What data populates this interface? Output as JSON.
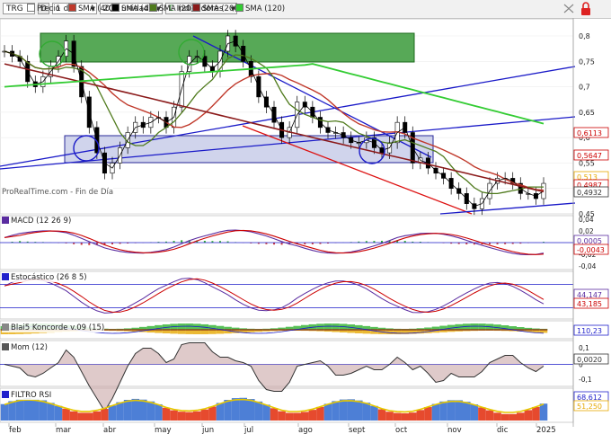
{
  "toolbar": {
    "ticker": "TRG",
    "badge": "D",
    "period": "1 día",
    "units": "200 unidades",
    "indicators_label": "Indicadores"
  },
  "legend": [
    {
      "label": "Precio",
      "color": "#ffffff"
    },
    {
      "label": "SMA (40)",
      "color": "#c0392b"
    },
    {
      "label": "SMA (4)",
      "color": "#000000"
    },
    {
      "label": "SMA (20)",
      "color": "#4f7a1c"
    },
    {
      "label": "SMA (200)",
      "color": "#8b1a1a"
    },
    {
      "label": "SMA (120)",
      "color": "#33cc33"
    }
  ],
  "watermark": "ProRealTime.com - Fin de Día",
  "panels": {
    "macd": {
      "title": "MACD (12 26 9)",
      "color": "#5a2ca0"
    },
    "stoch": {
      "title": "Estocástico (26 8 5)",
      "color": "#2222cc"
    },
    "blai5": {
      "title": "Blai5 Koncorde v.09 (15)",
      "color": "#888888"
    },
    "mom": {
      "title": "Mom (12)",
      "color": "#555555"
    },
    "rsi": {
      "title": "FILTRO RSI",
      "color": "#2222cc"
    }
  },
  "chart_data": {
    "type": "candlestick",
    "x_axis_labels": [
      "feb",
      "mar",
      "abr",
      "may",
      "jun",
      "jul",
      "ago",
      "sept",
      "oct",
      "nov",
      "dic",
      "2025"
    ],
    "price": {
      "ylim": [
        0.45,
        0.82
      ],
      "y_ticks": [
        "0,8",
        "0,75",
        "0,7",
        "0,65",
        "0,6",
        "0,55",
        "0,5",
        "0,45"
      ],
      "close_series": [
        0.77,
        0.76,
        0.75,
        0.71,
        0.7,
        0.72,
        0.74,
        0.76,
        0.79,
        0.74,
        0.68,
        0.62,
        0.57,
        0.53,
        0.55,
        0.58,
        0.61,
        0.63,
        0.62,
        0.64,
        0.64,
        0.62,
        0.66,
        0.73,
        0.76,
        0.76,
        0.74,
        0.73,
        0.77,
        0.8,
        0.78,
        0.75,
        0.72,
        0.68,
        0.66,
        0.63,
        0.6,
        0.62,
        0.67,
        0.66,
        0.64,
        0.62,
        0.61,
        0.61,
        0.6,
        0.59,
        0.59,
        0.6,
        0.58,
        0.57,
        0.59,
        0.63,
        0.61,
        0.55,
        0.56,
        0.54,
        0.53,
        0.52,
        0.5,
        0.49,
        0.47,
        0.46,
        0.48,
        0.51,
        0.52,
        0.52,
        0.51,
        0.49,
        0.49,
        0.48,
        0.51
      ],
      "price_labels": [
        {
          "text": "0,6113",
          "color": "#cc0000"
        },
        {
          "text": "0,5647",
          "color": "#cc0000"
        },
        {
          "text": "0,513",
          "color": "#e6a800"
        },
        {
          "text": "0,4987",
          "color": "#cc0000"
        },
        {
          "text": "0,4932",
          "color": "#333333"
        }
      ]
    },
    "macd": {
      "ylim": [
        -0.04,
        0.04
      ],
      "y_ticks": [
        "0,04",
        "0,02",
        "0",
        "-0,02",
        "-0,04"
      ],
      "labels": [
        {
          "text": "0,0005",
          "color": "#5a2ca0"
        },
        {
          "text": "-0,0043",
          "color": "#cc0000"
        }
      ]
    },
    "stochastic": {
      "labels": [
        {
          "text": "44,147",
          "color": "#5a2ca0"
        },
        {
          "text": "43,185",
          "color": "#cc0000"
        }
      ]
    },
    "blai5": {
      "labels": [
        {
          "text": "110,23",
          "color": "#2222cc"
        }
      ]
    },
    "momentum": {
      "y_ticks": [
        "0,1",
        "0",
        "-0,1"
      ],
      "labels": [
        {
          "text": "0,0020",
          "color": "#333333"
        }
      ]
    },
    "rsi_filter": {
      "labels": [
        {
          "text": "68,612",
          "color": "#2222cc"
        },
        {
          "text": "51,250",
          "color": "#e6a800"
        }
      ]
    }
  }
}
